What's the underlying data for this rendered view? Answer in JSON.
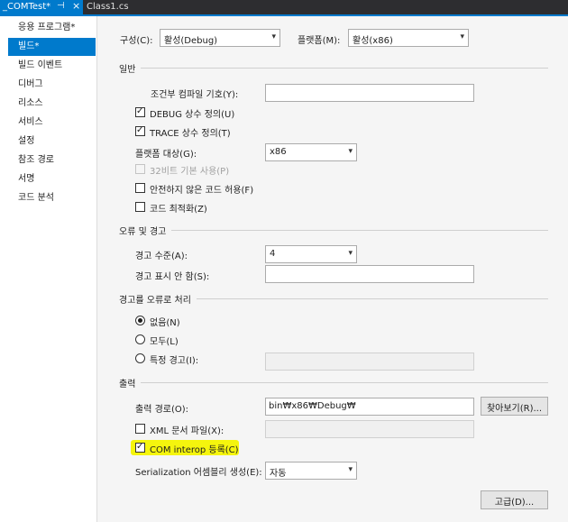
{
  "tabs": {
    "active_title": "_COMTest*",
    "pin_glyph": "⊣",
    "close_glyph": "×",
    "inactive_title": "Class1.cs"
  },
  "sidebar": {
    "items": [
      {
        "label": "응용 프로그램*"
      },
      {
        "label": "빌드*"
      },
      {
        "label": "빌드 이벤트"
      },
      {
        "label": "디버그"
      },
      {
        "label": "리소스"
      },
      {
        "label": "서비스"
      },
      {
        "label": "설정"
      },
      {
        "label": "참조 경로"
      },
      {
        "label": "서명"
      },
      {
        "label": "코드 분석"
      }
    ]
  },
  "config": {
    "config_label": "구성(C):",
    "config_value": "활성(Debug)",
    "platform_label": "플랫폼(M):",
    "platform_value": "활성(x86)"
  },
  "general": {
    "title": "일반",
    "conditional_label": "조건부 컴파일 기호(Y):",
    "conditional_value": "",
    "define_debug": "DEBUG 상수 정의(U)",
    "define_debug_checked": true,
    "define_trace": "TRACE 상수 정의(T)",
    "define_trace_checked": true,
    "platform_target_label": "플랫폼 대상(G):",
    "platform_target_value": "x86",
    "prefer32_label": "32비트 기본 사용(P)",
    "prefer32_checked": false,
    "unsafe_label": "안전하지 않은 코드 허용(F)",
    "unsafe_checked": false,
    "optimize_label": "코드 최적화(Z)",
    "optimize_checked": false
  },
  "errors": {
    "title": "오류 및 경고",
    "warning_level_label": "경고 수준(A):",
    "warning_level_value": "4",
    "suppress_label": "경고 표시 안 함(S):",
    "suppress_value": ""
  },
  "treat_warnings": {
    "title": "경고를 오류로 처리",
    "none_label": "없음(N)",
    "all_label": "모두(L)",
    "specific_label": "특정 경고(I):",
    "selected": "none"
  },
  "output": {
    "title": "출력",
    "path_label": "출력 경로(O):",
    "path_value": "bin₩x86₩Debug₩",
    "browse_label": "찾아보기(R)...",
    "xml_label": "XML 문서 파일(X):",
    "xml_checked": false,
    "com_label": "COM interop 등록(C)",
    "com_checked": true,
    "serialization_label": "Serialization 어셈블리 생성(E):",
    "serialization_value": "자동",
    "advanced_label": "고급(D)..."
  },
  "icons": {
    "dropdown": "▾",
    "check": "✓"
  },
  "colors": {
    "accent": "#007acc",
    "highlight": "#f4f400"
  }
}
